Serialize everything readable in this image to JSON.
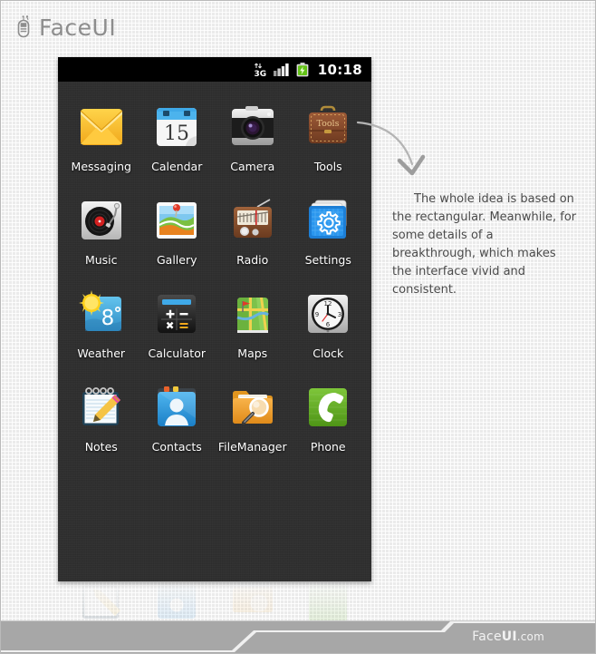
{
  "brand": {
    "name": "FaceUI",
    "logo_icon": "faceui-phone-logo-icon"
  },
  "phone": {
    "statusbar": {
      "time": "10:18",
      "icons": [
        {
          "name": "network-3g-icon",
          "label": "3G"
        },
        {
          "name": "signal-bars-icon",
          "label": "signal"
        },
        {
          "name": "battery-charging-icon",
          "label": "battery"
        }
      ]
    },
    "apps": [
      {
        "label": "Messaging",
        "icon": "messaging-envelope-icon"
      },
      {
        "label": "Calendar",
        "icon": "calendar-icon",
        "day": "15"
      },
      {
        "label": "Camera",
        "icon": "camera-icon"
      },
      {
        "label": "Tools",
        "icon": "tools-briefcase-icon",
        "badge_text": "Tools"
      },
      {
        "label": "Music",
        "icon": "music-turntable-icon"
      },
      {
        "label": "Gallery",
        "icon": "gallery-photo-pin-icon"
      },
      {
        "label": "Radio",
        "icon": "radio-icon"
      },
      {
        "label": "Settings",
        "icon": "settings-gear-icon"
      },
      {
        "label": "Weather",
        "icon": "weather-sun-icon",
        "temperature": "8"
      },
      {
        "label": "Calculator",
        "icon": "calculator-icon"
      },
      {
        "label": "Maps",
        "icon": "maps-flag-icon"
      },
      {
        "label": "Clock",
        "icon": "clock-analog-icon",
        "clock_marks": [
          "12",
          "3",
          "6",
          "9"
        ]
      },
      {
        "label": "Notes",
        "icon": "notes-pencil-icon"
      },
      {
        "label": "Contacts",
        "icon": "contacts-person-icon"
      },
      {
        "label": "FileManager",
        "icon": "filemanager-folder-search-icon"
      },
      {
        "label": "Phone",
        "icon": "phone-handset-icon"
      }
    ]
  },
  "annotation": {
    "text": "The whole idea is based on the rectangular. Meanwhile, for some details of a breakthrough, which makes the interface vivid and consistent.",
    "arrow_icon": "curved-arrow-icon"
  },
  "footer": {
    "site_prefix": "Face",
    "site_bold": "UI",
    "site_suffix": ".com"
  },
  "colors": {
    "page_bg": "#ebebeb",
    "phone_bg": "#2e2e2e",
    "statusbar_bg": "#000000",
    "footer_bg": "#a7a7a7",
    "label_text": "#ffffff",
    "annotation_text": "#4a4a4a",
    "brand_text": "#8d8d8d"
  }
}
